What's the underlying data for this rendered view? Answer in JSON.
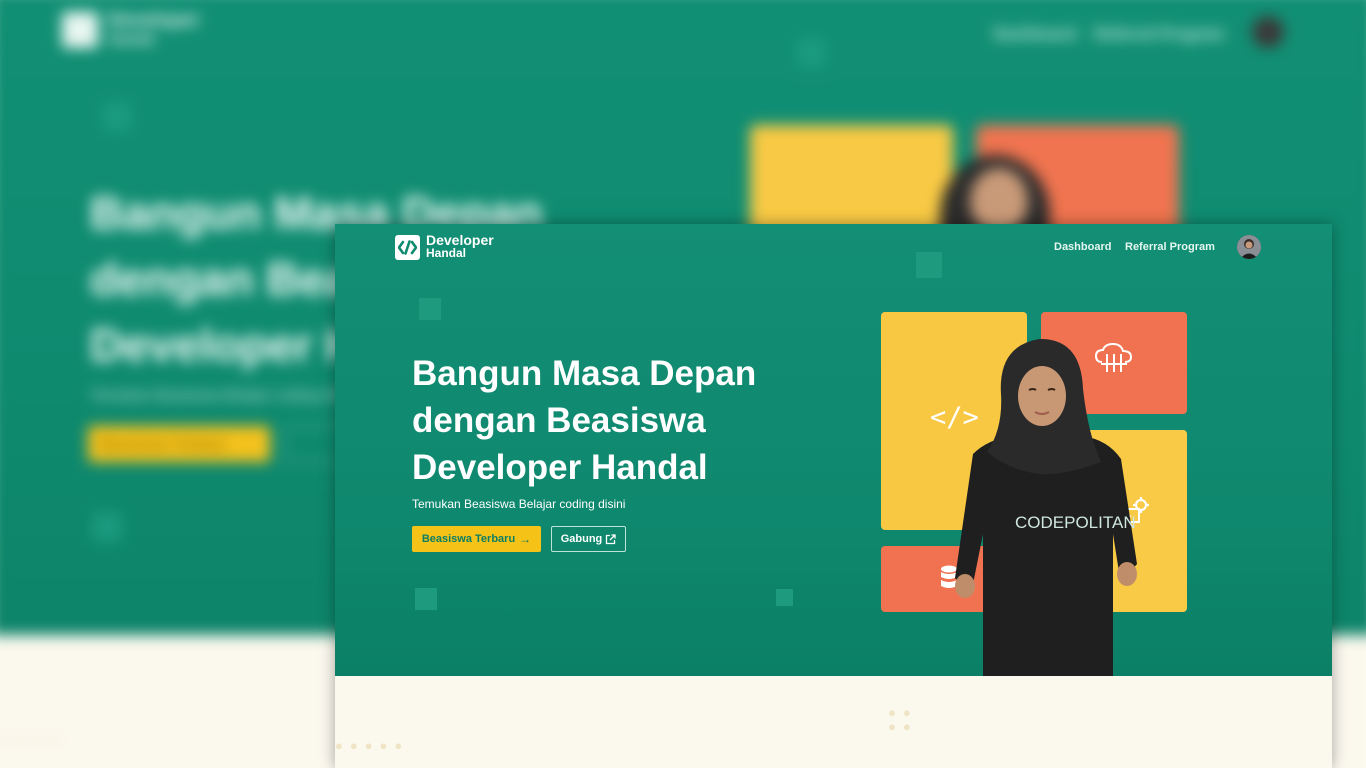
{
  "brand": {
    "line1": "Developer",
    "line2": "Handal"
  },
  "nav": {
    "dashboard": "Dashboard",
    "referral": "Referral Program"
  },
  "hero": {
    "title_line1": "Bangun Masa Depan",
    "title_line2": "dengan Beasiswa",
    "title_line3": "Developer Handal",
    "subtitle": "Temukan Beasiswa Belajar coding disini",
    "primary_button": "Beasiswa Terbaru",
    "secondary_button": "Gabung"
  },
  "illustration": {
    "shirt_text": "CODEPOLITAN",
    "code_symbol": "</>"
  },
  "icons": [
    "developer-handal-logo-icon",
    "arrow-right-icon",
    "external-link-icon",
    "code-icon",
    "cloud-network-icon",
    "database-icon",
    "gear-icon"
  ],
  "colors": {
    "brand_green": "#0e8a6f",
    "accent_yellow": "#f5c318",
    "accent_orange": "#f07250",
    "cream": "#fbf8ee"
  }
}
